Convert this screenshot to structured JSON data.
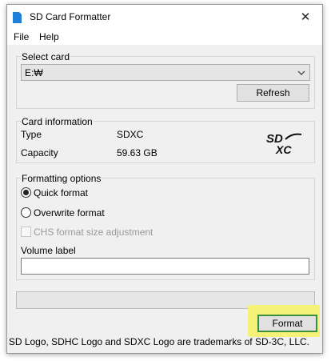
{
  "window": {
    "title": "SD Card Formatter",
    "close_glyph": "✕"
  },
  "menu": {
    "items": [
      {
        "label": "File"
      },
      {
        "label": "Help"
      }
    ]
  },
  "select_card": {
    "group_label": "Select card",
    "selected": "E:₩",
    "refresh_label": "Refresh"
  },
  "card_info": {
    "group_label": "Card information",
    "type_label": "Type",
    "type_value": "SDXC",
    "capacity_label": "Capacity",
    "capacity_value": "59.63 GB",
    "logo_text_top": "SD",
    "logo_text_bottom": "XC"
  },
  "formatting": {
    "group_label": "Formatting options",
    "quick_format_label": "Quick format",
    "quick_format_selected": true,
    "overwrite_format_label": "Overwrite format",
    "overwrite_format_selected": false,
    "chs_label": "CHS format size adjustment",
    "chs_checked": false,
    "chs_enabled": false,
    "volume_label_caption": "Volume label",
    "volume_label_value": ""
  },
  "progress": {
    "fraction": 0
  },
  "actions": {
    "format_label": "Format"
  },
  "footer": {
    "trademark_text": "SD Logo, SDHC Logo and SDXC Logo are trademarks of SD-3C, LLC."
  },
  "colors": {
    "highlight": "#f5f27a",
    "format_border": "#3c8d3c",
    "app_icon": "#1e7fd6"
  },
  "icons": {
    "app": "sd-card-icon",
    "close": "close-icon",
    "dropdown": "chevron-down-icon",
    "logo": "sdxc-logo"
  }
}
